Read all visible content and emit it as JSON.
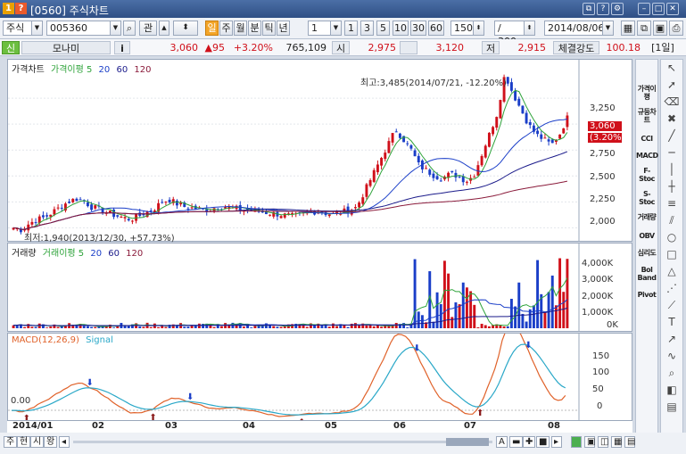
{
  "window": {
    "badge1": "1",
    "badge2": "?",
    "title": "[0560] 주식차트",
    "controls": [
      "⧉",
      "?",
      "⚙",
      "–",
      "□",
      "✕"
    ]
  },
  "toolbar": {
    "market": "주식",
    "code": "005360",
    "watch_label": "관",
    "period_buttons": [
      "일",
      "주",
      "월",
      "분",
      "틱",
      "년"
    ],
    "active_period": "일",
    "interval_value": "1",
    "interval_buttons": [
      "1",
      "3",
      "5",
      "10",
      "30",
      "60"
    ],
    "count_value": "150",
    "total": "/ 300",
    "date": "2014/08/06"
  },
  "infobar": {
    "market_tag": "신",
    "stock_name": "모나미",
    "info_btn": "i",
    "price": "3,060",
    "change": "▲95",
    "change_pct": "+3.20%",
    "volume": "765,109",
    "open_label": "시",
    "open": "2,975",
    "high": "3,120",
    "low_label": "저",
    "low": "2,915",
    "strength_label": "체결강도",
    "strength": "100.18",
    "period_label": "[1일]"
  },
  "price_panel": {
    "legend_title": "가격차트",
    "legend_ma": "가격이평 5",
    "legend_20": "20",
    "legend_60": "60",
    "legend_120": "120",
    "high_annotation": "최고:3,485(2014/07/21, -12.20%)",
    "low_annotation": "최저:1,940(2013/12/30, +57.73%)",
    "current_price_tag": "3,060",
    "current_pct_tag": "(3.20%)",
    "y_ticks": [
      "3,250",
      "3,000",
      "2,750",
      "2,500",
      "2,250",
      "2,000"
    ]
  },
  "volume_panel": {
    "legend_title": "거래량",
    "legend_ma": "거래이평 5",
    "legend_20": "20",
    "legend_60": "60",
    "legend_120": "120",
    "y_ticks": [
      "4,000K",
      "3,000K",
      "2,000K",
      "1,000K",
      "0K"
    ]
  },
  "macd_panel": {
    "legend_title": "MACD(12,26,9)",
    "legend_signal": "Signal",
    "y_ticks": [
      "150",
      "100",
      "50",
      "0"
    ],
    "left_label": "0.00"
  },
  "x_axis": {
    "labels": [
      "2014/01",
      "02",
      "03",
      "04",
      "05",
      "06",
      "07",
      "08"
    ]
  },
  "right_toolbar": {
    "items": [
      "가격이평",
      "규등차트",
      "CCI",
      "MACD",
      "F-Stoc",
      "S-Stoc",
      "거래량",
      "OBV",
      "심리도",
      "Bol Band",
      "Pivot"
    ]
  },
  "bottom_bar": {
    "tabs": [
      "주",
      "현",
      "시",
      "왕"
    ],
    "zoom": [
      "A",
      "▬",
      "✚",
      "■"
    ]
  },
  "colors": {
    "up": "#d0101a",
    "down": "#1a3ec8",
    "ma5": "#2ea33a",
    "ma20": "#1a3ec8",
    "ma60": "#1a1a8a",
    "ma120": "#8a1a3a",
    "macd": "#e0622a",
    "signal": "#2aa8c8"
  },
  "chart_data": {
    "type": "candlestick",
    "x_range": [
      "2013/12",
      "2014/08/06"
    ],
    "price_ylim": [
      1900,
      3500
    ],
    "price_path": [
      2000,
      1980,
      2040,
      2080,
      2100,
      2150,
      2200,
      2250,
      2280,
      2260,
      2200,
      2180,
      2150,
      2120,
      2100,
      2080,
      2110,
      2150,
      2180,
      2250,
      2270,
      2230,
      2200,
      2190,
      2180,
      2170,
      2200,
      2210,
      2190,
      2180,
      2170,
      2160,
      2150,
      2140,
      2130,
      2120,
      2110,
      2130,
      2150,
      2160,
      2140,
      2130,
      2150,
      2170,
      2200,
      2350,
      2500,
      2650,
      2800,
      2950,
      2850,
      2750,
      2600,
      2550,
      2500,
      2480,
      2520,
      2500,
      2450,
      2500,
      2700,
      2900,
      3100,
      3485,
      3300,
      3150,
      3000,
      2900,
      2850,
      2800,
      2900,
      3060
    ],
    "volume_ylim": [
      0,
      4500
    ],
    "volume_unit": "K",
    "macd_ylim": [
      -20,
      170
    ]
  }
}
